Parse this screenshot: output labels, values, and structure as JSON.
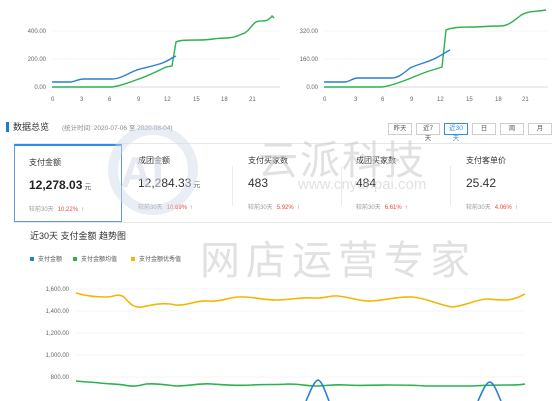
{
  "top_charts": [
    {
      "y_ticks": [
        "0.00",
        "200.00",
        "400.00"
      ],
      "x_ticks": [
        "0",
        "3",
        "6",
        "9",
        "12",
        "15",
        "18",
        "21"
      ],
      "colors": {
        "green": "#2bb24c",
        "blue": "#2a7fd4"
      }
    },
    {
      "y_ticks": [
        "0.00",
        "160.00",
        "320.00"
      ],
      "x_ticks": [
        "0",
        "3",
        "6",
        "9",
        "12",
        "15",
        "18",
        "21"
      ],
      "colors": {
        "green": "#2bb24c",
        "blue": "#2a7fd4"
      }
    }
  ],
  "overview": {
    "title": "数据总览",
    "range": "(统计时间: 2020-07-06 至 2020-08-04)",
    "range_buttons": [
      "昨天",
      "近7天",
      "近30天",
      "日",
      "周",
      "月"
    ],
    "active_button": "近30天"
  },
  "cards": [
    {
      "title": "支付金额",
      "value": "12,278.03",
      "unit": "元",
      "compare": "较前30天",
      "pct": "10.22%",
      "arrow": "↑"
    },
    {
      "title": "成团金额",
      "value": "12,284.33",
      "unit": "元",
      "compare": "较前30天",
      "pct": "10.69%",
      "arrow": "↑"
    },
    {
      "title": "支付买家数",
      "value": "483",
      "unit": "",
      "compare": "较前30天",
      "pct": "5.92%",
      "arrow": "↑"
    },
    {
      "title": "成团买家数",
      "value": "484",
      "unit": "",
      "compare": "较前30天",
      "pct": "6.61%",
      "arrow": "↑"
    },
    {
      "title": "支付客单价",
      "value": "25.42",
      "unit": "",
      "compare": "较前30天",
      "pct": "4.06%",
      "arrow": "↑"
    }
  ],
  "trend": {
    "title": "近30天 支付金额 趋势图",
    "legend": [
      {
        "name": "支付金额",
        "color": "#2a7fd4"
      },
      {
        "name": "支付金额均值",
        "color": "#2bb24c"
      },
      {
        "name": "支付金额优秀值",
        "color": "#f2b705"
      }
    ],
    "y_ticks": [
      "800.00",
      "1,000.00",
      "1,200.00",
      "1,400.00",
      "1,600.00"
    ]
  },
  "watermark": {
    "logo_text": "AI",
    "brand": "云派科技",
    "url": "www.cnyunpai.com",
    "slogan": "网店运营专家"
  }
}
